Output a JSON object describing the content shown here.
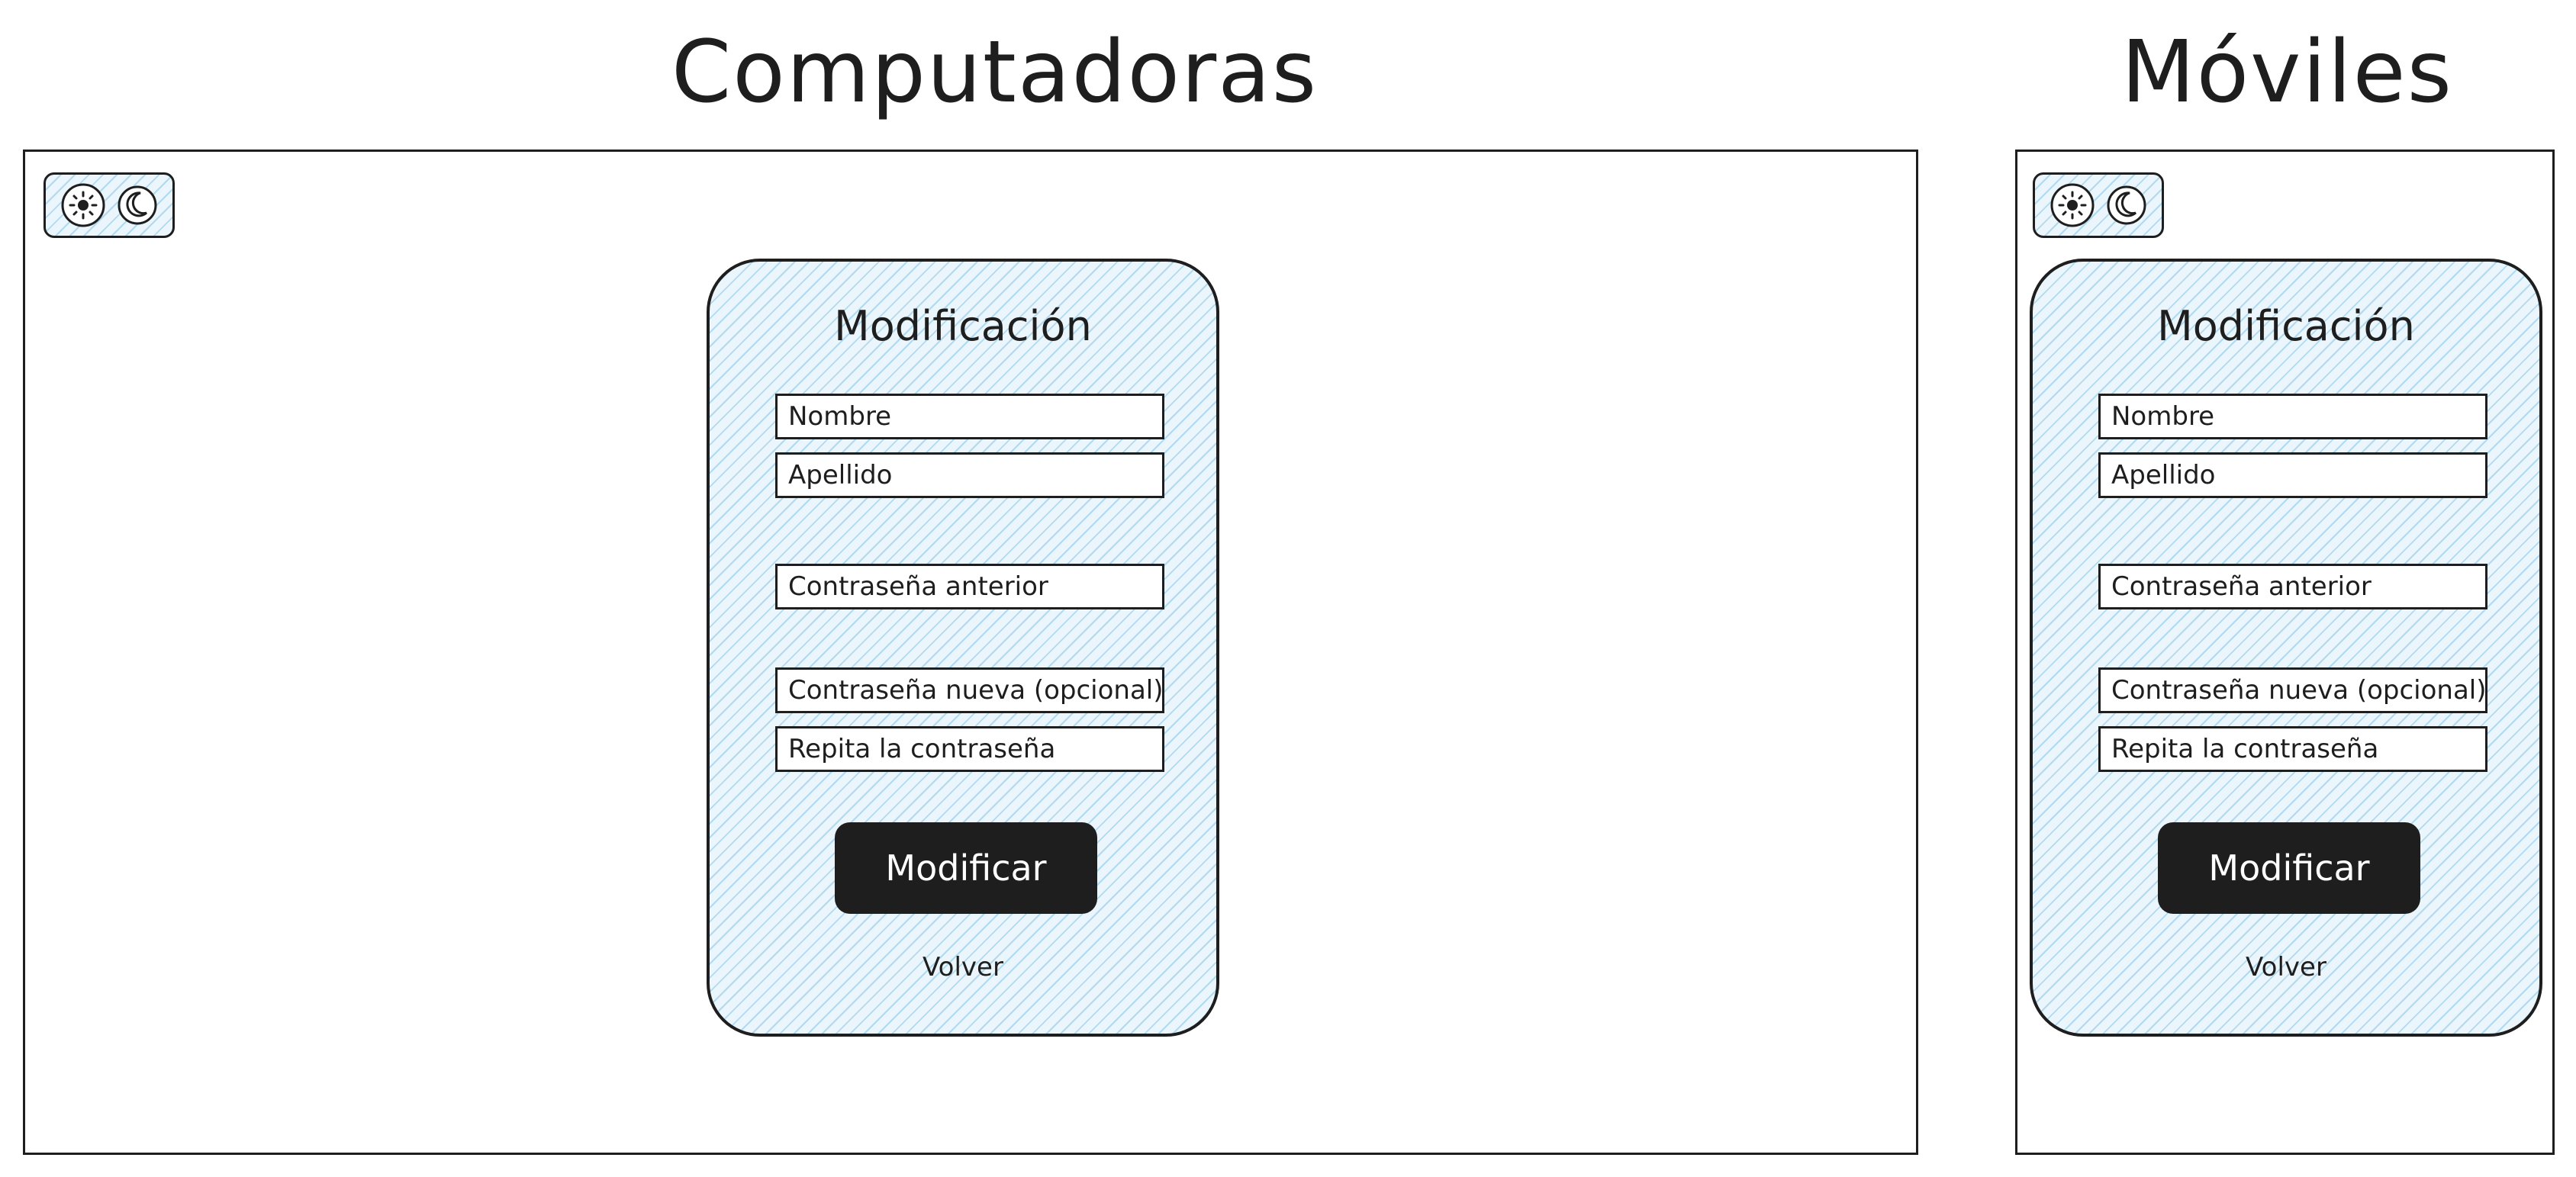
{
  "headings": {
    "desktop": "Computadoras",
    "mobile": "Móviles"
  },
  "theme_toggle": {
    "icons": [
      "sun-icon",
      "moon-icon"
    ]
  },
  "form": {
    "title": "Modificación",
    "fields": {
      "first_name": "Nombre",
      "last_name": "Apellido",
      "old_password": "Contraseña anterior",
      "new_password": "Contraseña nueva (opcional)",
      "repeat_password": "Repita la contraseña"
    },
    "submit_label": "Modificar",
    "back_label": "Volver"
  },
  "colors": {
    "ink": "#1e1e1e",
    "card_fill": "#a5d8ff",
    "button_fill": "#1e1e1e",
    "button_text": "#ffffff"
  }
}
